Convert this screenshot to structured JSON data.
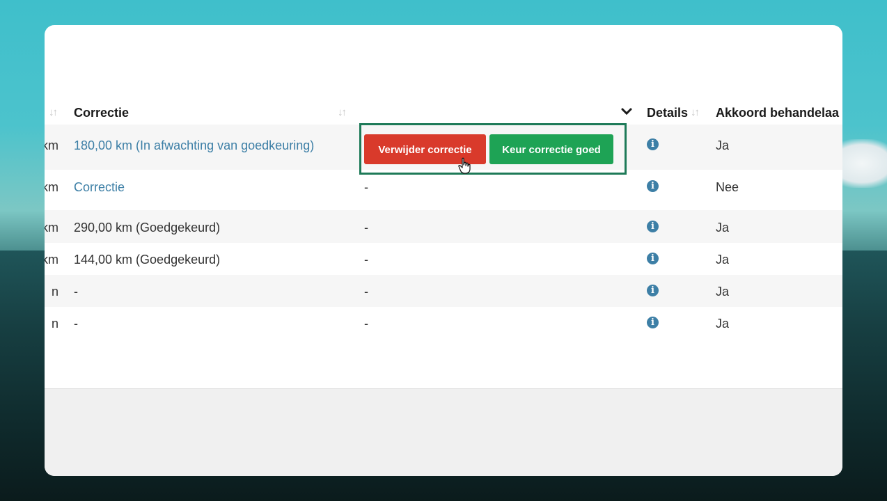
{
  "table": {
    "headers": {
      "correctie": "Correctie",
      "details": "Details",
      "akkoord": "Akkoord behandelaa"
    },
    "rows": [
      {
        "prev_clip": "km",
        "correctie": "180,00 km (In afwachting van goedkeuring)",
        "correctie_is_link": true,
        "actie": "",
        "akkoord": "Ja"
      },
      {
        "prev_clip": "km",
        "correctie": "Correctie",
        "correctie_is_link": true,
        "actie": "-",
        "akkoord": "Nee"
      },
      {
        "prev_clip": "km",
        "correctie": "290,00 km (Goedgekeurd)",
        "correctie_is_link": false,
        "actie": "-",
        "akkoord": "Ja"
      },
      {
        "prev_clip": "km",
        "correctie": "144,00 km (Goedgekeurd)",
        "correctie_is_link": false,
        "actie": "-",
        "akkoord": "Ja"
      },
      {
        "prev_clip": "n",
        "correctie": "-",
        "correctie_is_link": false,
        "actie": "-",
        "akkoord": "Ja"
      },
      {
        "prev_clip": "n",
        "correctie": "-",
        "correctie_is_link": false,
        "actie": "-",
        "akkoord": "Ja"
      }
    ]
  },
  "actions": {
    "delete_label": "Verwijder correctie",
    "approve_label": "Keur correctie goed"
  },
  "icons": {
    "sort": "sort-icon",
    "chevron": "chevron-down-icon",
    "info": "info-icon",
    "cursor": "hand-pointer-icon"
  },
  "colors": {
    "link": "#3d7fa6",
    "delete": "#d93a2b",
    "approve": "#1ea355",
    "highlight": "#1e7a58"
  }
}
